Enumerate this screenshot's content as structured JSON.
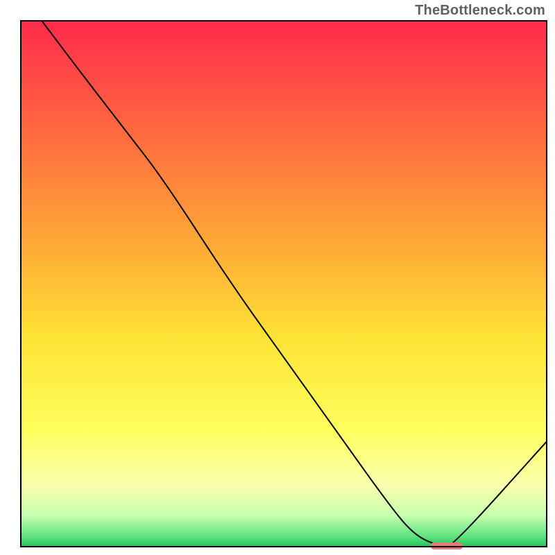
{
  "watermark": "TheBottleneck.com",
  "chart_data": {
    "type": "line",
    "title": "",
    "xlabel": "",
    "ylabel": "",
    "xlim": [
      0,
      100
    ],
    "ylim": [
      0,
      100
    ],
    "grid": false,
    "series": [
      {
        "name": "bottleneck-curve",
        "x": [
          4,
          10,
          20,
          27,
          40,
          50,
          60,
          70,
          75,
          80,
          82,
          100
        ],
        "y": [
          100,
          92,
          79,
          70,
          50,
          36,
          22,
          8,
          2,
          0,
          0,
          20
        ]
      }
    ],
    "marker": {
      "name": "optimal-marker",
      "x_center": 81,
      "width": 3,
      "color": "#e77877"
    },
    "background_gradient": {
      "stops": [
        {
          "offset": 0,
          "color": "#ff2a4b"
        },
        {
          "offset": 45,
          "color": "#ffb035"
        },
        {
          "offset": 60,
          "color": "#ffe236"
        },
        {
          "offset": 78,
          "color": "#feff5d"
        },
        {
          "offset": 88,
          "color": "#fbffac"
        },
        {
          "offset": 94,
          "color": "#c8ffb0"
        },
        {
          "offset": 98,
          "color": "#61e27f"
        },
        {
          "offset": 100,
          "color": "#1fc45a"
        }
      ]
    },
    "frame": {
      "stroke": "#000000",
      "stroke_width": 2,
      "inset_top": 30,
      "inset_left": 30,
      "inset_right": 12,
      "inset_bottom": 12
    }
  }
}
